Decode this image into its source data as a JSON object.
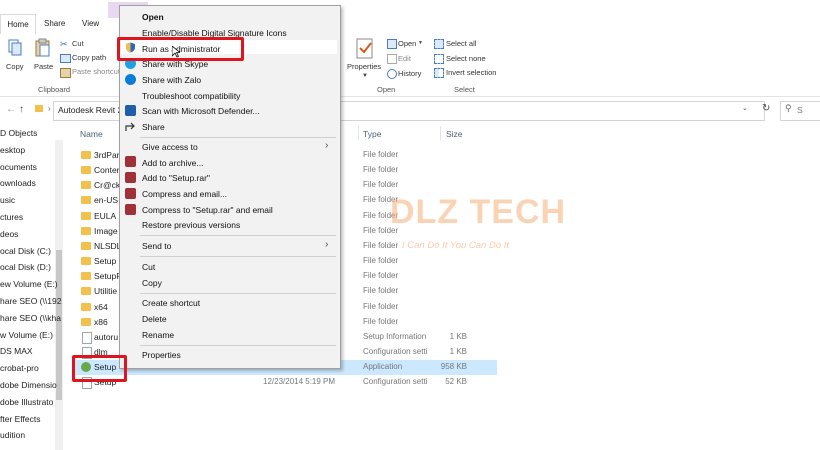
{
  "tabs": {
    "home": "Home",
    "share": "Share",
    "view": "View"
  },
  "ribbon": {
    "copy": "Copy",
    "paste": "Paste",
    "cut": "Cut",
    "copy_path": "Copy path",
    "paste_shortcut": "Paste shortcut",
    "clipboard_group": "Clipboard",
    "properties": "Properties",
    "open_dropdown": "Open",
    "edit": "Edit",
    "history": "History",
    "open_group": "Open",
    "select_all": "Select all",
    "select_none": "Select none",
    "invert_selection": "Invert selection",
    "select_group": "Select"
  },
  "address": {
    "path": "Autodesk Revit 2",
    "search_placeholder": "S"
  },
  "nav_items": [
    "D Objects",
    "esktop",
    "ocuments",
    "ownloads",
    "usic",
    "ctures",
    "deos",
    "ocal Disk (C:)",
    "ocal Disk (D:)",
    "ew Volume (E:)",
    "hare SEO (\\\\192",
    "hare SEO (\\\\kha",
    "w Volume (E:)",
    "DS MAX",
    "crobat-pro",
    "dobe Dimensio",
    "dobe Illustrato",
    "fter Effects",
    "udition"
  ],
  "columns": {
    "name": "Name",
    "type": "Type",
    "size": "Size"
  },
  "files": [
    {
      "name": "3rdPar",
      "date": "",
      "type": "File folder",
      "size": "",
      "kind": "folder"
    },
    {
      "name": "Conter",
      "date": "",
      "type": "File folder",
      "size": "",
      "kind": "folder"
    },
    {
      "name": "Cr@ck",
      "date": "",
      "type": "File folder",
      "size": "",
      "kind": "folder"
    },
    {
      "name": "en-US",
      "date": "",
      "type": "File folder",
      "size": "",
      "kind": "folder"
    },
    {
      "name": "EULA",
      "date": "",
      "type": "File folder",
      "size": "",
      "kind": "folder"
    },
    {
      "name": "Image",
      "date": "",
      "type": "File folder",
      "size": "",
      "kind": "folder"
    },
    {
      "name": "NLSDL",
      "date": "",
      "type": "File folder",
      "size": "",
      "kind": "folder"
    },
    {
      "name": "Setup",
      "date": "",
      "type": "File folder",
      "size": "",
      "kind": "folder"
    },
    {
      "name": "SetupR",
      "date": "",
      "type": "File folder",
      "size": "",
      "kind": "folder"
    },
    {
      "name": "Utilitie",
      "date": "",
      "type": "File folder",
      "size": "",
      "kind": "folder"
    },
    {
      "name": "x64",
      "date": "",
      "type": "File folder",
      "size": "",
      "kind": "folder"
    },
    {
      "name": "x86",
      "date": "",
      "type": "File folder",
      "size": "",
      "kind": "folder"
    },
    {
      "name": "autoru",
      "date": "",
      "type": "Setup Information",
      "size": "1 KB",
      "kind": "file"
    },
    {
      "name": "dlm",
      "date": "",
      "type": "Configuration setti",
      "size": "1 KB",
      "kind": "file"
    },
    {
      "name": "Setup",
      "date": "12/23/2014 5:19 PM",
      "type": "Application",
      "size": "958 KB",
      "kind": "app"
    },
    {
      "name": "Setup",
      "date": "12/23/2014 5:19 PM",
      "type": "Configuration setti",
      "size": "52 KB",
      "kind": "file"
    }
  ],
  "menu": {
    "open": "Open",
    "digital_signature": "Enable/Disable Digital Signature Icons",
    "run_as_admin": "Run as administrator",
    "share_skype": "Share with Skype",
    "share_zalo": "Share with Zalo",
    "troubleshoot": "Troubleshoot compatibility",
    "defender": "Scan with Microsoft Defender...",
    "share": "Share",
    "give_access": "Give access to",
    "add_archive": "Add to archive...",
    "add_setup_rar": "Add to \"Setup.rar\"",
    "compress_email": "Compress and email...",
    "compress_setup_email": "Compress to \"Setup.rar\" and email",
    "restore_versions": "Restore previous versions",
    "send_to": "Send to",
    "cut": "Cut",
    "copy": "Copy",
    "create_shortcut": "Create shortcut",
    "delete": "Delete",
    "rename": "Rename",
    "properties": "Properties"
  },
  "watermark": {
    "brand": "DLZ TECH",
    "tagline": "I Can Do It You Can Do It"
  },
  "colors": {
    "highlight_red": "#e0141e",
    "selection_blue": "#cce8ff",
    "folder_yellow": "#f1c14b",
    "watermark_orange": "#f5af78",
    "watermark_blue": "#5b7fc6"
  }
}
